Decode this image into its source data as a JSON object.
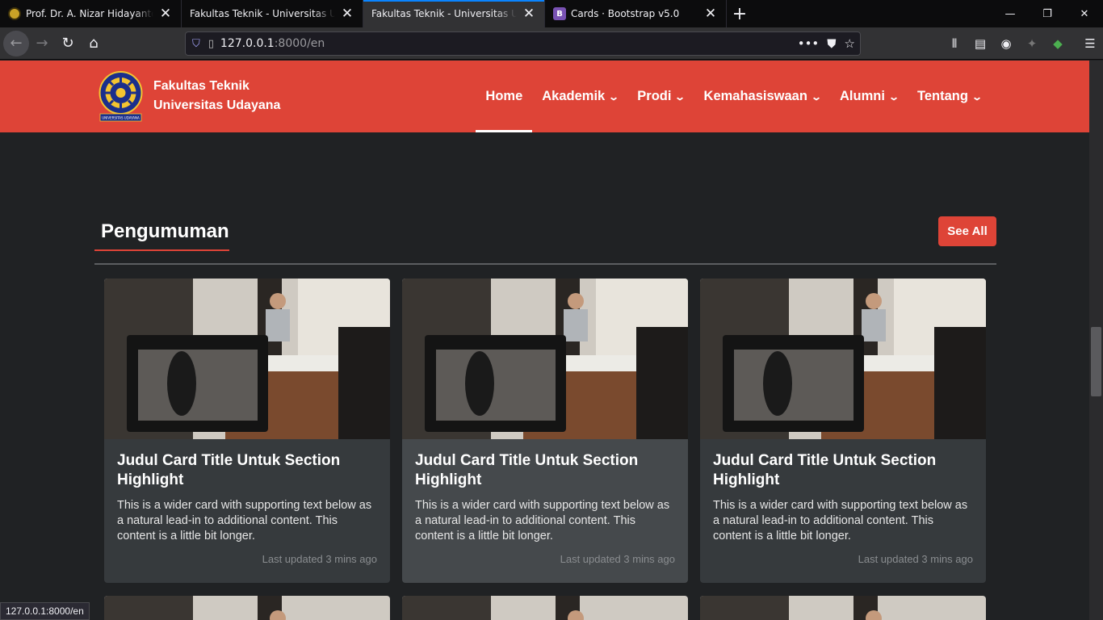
{
  "browser": {
    "tabs": [
      {
        "label": "Prof. Dr. A. Nizar Hidayanto – F",
        "icon": "university-seal-icon",
        "active": false
      },
      {
        "label": "Fakultas Teknik - Universitas Udayana",
        "icon": "",
        "active": false
      },
      {
        "label": "Fakultas Teknik - Universitas Udayana",
        "icon": "",
        "active": true
      },
      {
        "label": "Cards · Bootstrap v5.0",
        "icon": "bootstrap-icon",
        "active": false
      }
    ],
    "bootstrap_letter": "B",
    "url_host": "127.0.0.1",
    "url_rest": ":8000/en",
    "status_text": "127.0.0.1:8000/en"
  },
  "site": {
    "brand_line1": "Fakultas Teknik",
    "brand_line2": "Universitas Udayana",
    "logo_caption": "UNIVERSITAS UDAYANA",
    "nav": [
      {
        "label": "Home",
        "dropdown": false,
        "active": true
      },
      {
        "label": "Akademik",
        "dropdown": true
      },
      {
        "label": "Prodi",
        "dropdown": true
      },
      {
        "label": "Kemahasiswaan",
        "dropdown": true
      },
      {
        "label": "Alumni",
        "dropdown": true
      },
      {
        "label": "Tentang",
        "dropdown": true
      }
    ],
    "accent": "#de4437"
  },
  "announcements": {
    "title": "Pengumuman",
    "see_all": "See All",
    "cards": [
      {
        "title": "Judul Card Title Untuk Section Highlight",
        "text": "This is a wider card with supporting text below as a natural lead-in to additional content. This content is a little bit longer.",
        "updated": "Last updated 3 mins ago"
      },
      {
        "title": "Judul Card Title Untuk Section Highlight",
        "text": "This is a wider card with supporting text below as a natural lead-in to additional content. This content is a little bit longer.",
        "updated": "Last updated 3 mins ago"
      },
      {
        "title": "Judul Card Title Untuk Section Highlight",
        "text": "This is a wider card with supporting text below as a natural lead-in to additional content. This content is a little bit longer.",
        "updated": "Last updated 3 mins ago"
      }
    ]
  }
}
